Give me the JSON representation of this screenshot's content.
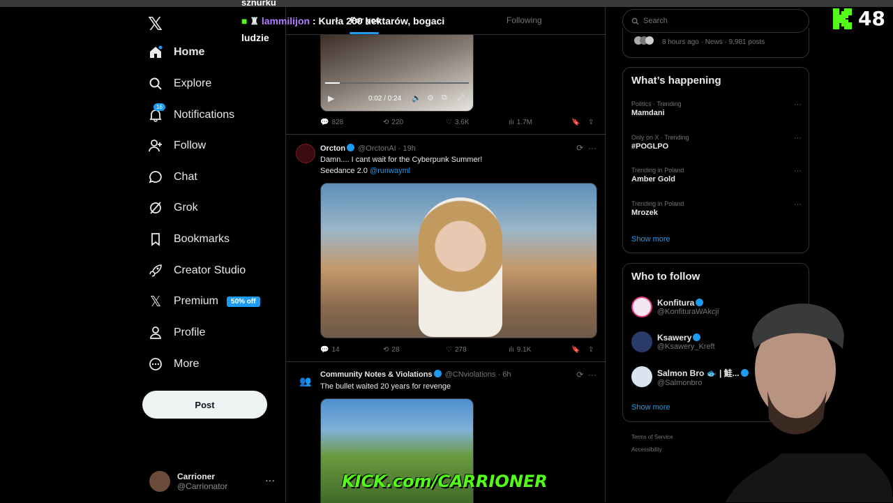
{
  "nav": {
    "home": "Home",
    "explore": "Explore",
    "notifications": "Notifications",
    "notifications_badge": "16",
    "follow": "Follow",
    "chat": "Chat",
    "grok": "Grok",
    "bookmarks": "Bookmarks",
    "creator_studio": "Creator Studio",
    "premium": "Premium",
    "premium_badge": "50% off",
    "profile": "Profile",
    "more": "More",
    "post_button": "Post"
  },
  "account": {
    "name": "Carrioner",
    "handle": "@Carrionator",
    "more": "···"
  },
  "feed": {
    "tabs": {
      "for_you": "For you",
      "following": "Following"
    },
    "post1": {
      "video_time": "0:02 / 0:24",
      "replies": "828",
      "reposts": "220",
      "likes": "3.6K",
      "views": "1.7M"
    },
    "post2": {
      "name": "Orcton",
      "handle": "@OrctonAI",
      "time": "· 19h",
      "text": "Damn.... I cant wait for the Cyberpunk Summer!",
      "text2": "Seedance 2.0 ",
      "mention": "@runwayml",
      "replies": "14",
      "reposts": "28",
      "likes": "278",
      "views": "9.1K"
    },
    "post3": {
      "name": "Community Notes & Violations",
      "handle": "@CNviolations",
      "time": "· 6h",
      "text": "The bullet waited 20 years for revenge"
    }
  },
  "search": {
    "placeholder": "Search"
  },
  "news": {
    "meta": "8 hours ago · News · 9,981 posts"
  },
  "trends": {
    "title": "What’s happening",
    "items": [
      {
        "meta": "Politics · Trending",
        "name": "Mamdani"
      },
      {
        "meta": "Only on X · Trending",
        "name": "#POGLPO"
      },
      {
        "meta": "Trending in Poland",
        "name": "Amber Gold"
      },
      {
        "meta": "Trending in Poland",
        "name": "Mrozek"
      }
    ],
    "show_more": "Show more"
  },
  "who_to_follow": {
    "title": "Who to follow",
    "items": [
      {
        "name": "Konfitura",
        "handle": "@KonfituraWAkcji"
      },
      {
        "name": "Ksawery",
        "handle": "@Ksawery_Kreft"
      },
      {
        "name": "Salmon Bro 🐟 | 鮭...",
        "handle": "@Salmonbro"
      }
    ],
    "show_more": "Show more"
  },
  "footer": {
    "terms": "Terms of Service",
    "accessibility": "Accessibility"
  },
  "overlay": {
    "chat_prev": "sznurku",
    "chat_user": "lammilijon",
    "chat_msg": " : Kurła 200 hektarów, bogaci",
    "chat_msg2": "ludzie",
    "viewer_count": "48",
    "kick_watermark": "KICK.com/CARRIONER"
  },
  "colors": {
    "accent": "#1d9bf0",
    "kick_green": "#53fc18",
    "chat_purple": "#b47cff"
  }
}
